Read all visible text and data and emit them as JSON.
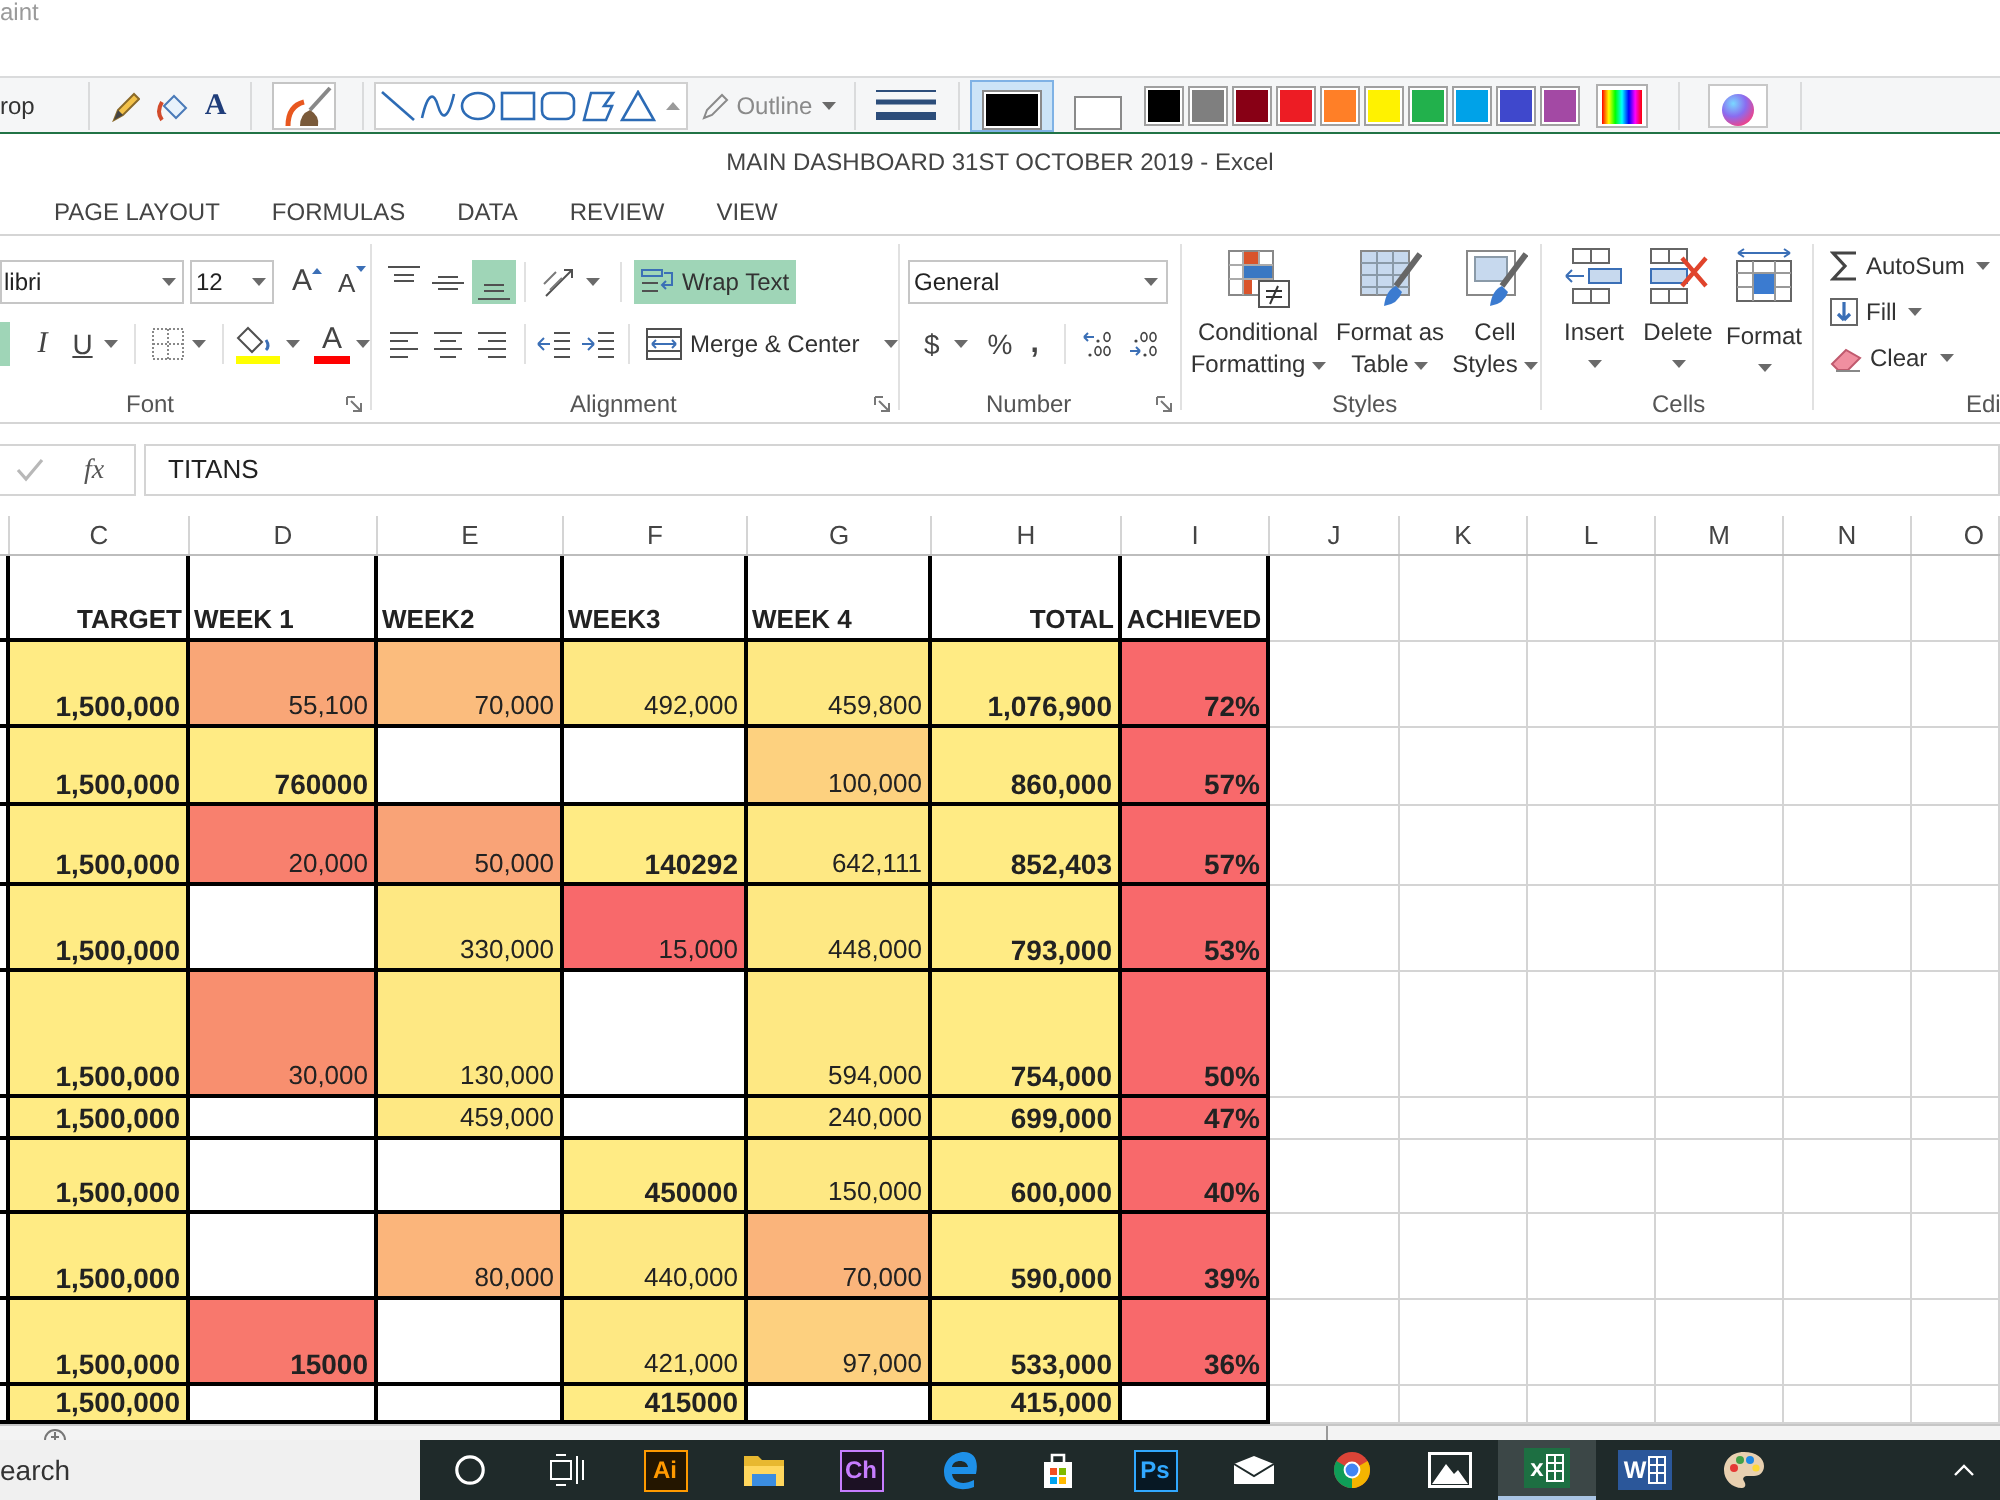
{
  "paint_window": {
    "title": "aint",
    "crop_label": "rop",
    "text_tool": "A",
    "outline": {
      "label": "Outline"
    },
    "current_colors": [
      {
        "color": "#000000",
        "selected": true
      },
      {
        "color": "#ffffff",
        "selected": false
      }
    ],
    "palette": [
      {
        "color": "#000000"
      },
      {
        "color": "#7f7f7f"
      },
      {
        "color": "#880015"
      },
      {
        "color": "#ed1c24"
      },
      {
        "color": "#ff7f27"
      },
      {
        "color": "#fff200"
      },
      {
        "color": "#22b14c"
      },
      {
        "color": "#00a2e8"
      },
      {
        "color": "#3f48cc"
      },
      {
        "color": "#a349a4"
      }
    ]
  },
  "excel": {
    "title": "MAIN DASHBOARD 31ST OCTOBER 2019 - Excel",
    "tabs": [
      {
        "label": "PAGE LAYOUT",
        "selected": false
      },
      {
        "label": "FORMULAS",
        "selected": false
      },
      {
        "label": "DATA",
        "selected": false
      },
      {
        "label": "REVIEW",
        "selected": false
      },
      {
        "label": "VIEW",
        "selected": false
      }
    ],
    "ribbon": {
      "font": {
        "label": "Font",
        "font_name": "libri",
        "font_size": "12",
        "grow_font": "A",
        "shrink_font": "A",
        "bold": {
          "on": true
        },
        "italic": {
          "label": "I",
          "on": false
        },
        "underline": {
          "label": "U",
          "on": false
        },
        "fill_color": {
          "color": "#ffff00"
        },
        "font_color": {
          "label": "A",
          "color": "#ff0000"
        }
      },
      "alignment": {
        "label": "Alignment",
        "top_align": {
          "on": false
        },
        "middle_align": {
          "on": false
        },
        "bottom_align": {
          "on": true
        },
        "left_align": {
          "on": false
        },
        "center_align": {
          "on": false
        },
        "right_align": {
          "on": false
        },
        "wrap_text": {
          "label": "Wrap Text",
          "on": true
        },
        "merge_center": {
          "label": "Merge & Center"
        }
      },
      "number": {
        "label": "Number",
        "format": "General",
        "currency": "$",
        "percent": "%",
        "comma": ","
      },
      "styles": {
        "label": "Styles",
        "buttons": [
          {
            "kind": "conditional_formatting",
            "label": "Conditional Formatting"
          },
          {
            "kind": "format_table",
            "label": "Format as Table"
          },
          {
            "kind": "cell_styles",
            "label": "Cell Styles"
          }
        ]
      },
      "cells": {
        "label": "Cells",
        "buttons": [
          {
            "kind": "insert",
            "label": "Insert"
          },
          {
            "kind": "delete",
            "label": "Delete"
          },
          {
            "kind": "format",
            "label": "Format"
          }
        ]
      },
      "editing": {
        "label": "Edi",
        "buttons": [
          {
            "kind": "autosum",
            "label": "AutoSum"
          },
          {
            "kind": "fill",
            "label": "Fill"
          },
          {
            "kind": "clear",
            "label": "Clear"
          }
        ]
      }
    },
    "formula_bar": {
      "function_label": "fx",
      "value": "TITANS"
    },
    "sheet": {
      "column_letters": [
        "C",
        "D",
        "E",
        "F",
        "G",
        "H",
        "I",
        "J",
        "K",
        "L",
        "M",
        "N",
        "O"
      ],
      "table": {
        "columns": [
          "TARGET",
          "WEEK 1",
          "WEEK2",
          "WEEK3",
          "WEEK 4",
          "TOTAL",
          "ACHIEVED"
        ],
        "rows": [
          {
            "cells": [
              {
                "value": "1,500,000",
                "color": "#ffeb84",
                "bold": true
              },
              {
                "value": "55,100",
                "color": "#f9a677",
                "bold": false
              },
              {
                "value": "70,000",
                "color": "#fbbc7d",
                "bold": false
              },
              {
                "value": "492,000",
                "color": "#fee883",
                "bold": false
              },
              {
                "value": "459,800",
                "color": "#fee883",
                "bold": false
              },
              {
                "value": "1,076,900",
                "color": "#ffeb84",
                "bold": true
              },
              {
                "value": "72%",
                "color": "#f8696b",
                "bold": true
              }
            ]
          },
          {
            "cells": [
              {
                "value": "1,500,000",
                "color": "#ffeb84",
                "bold": true
              },
              {
                "value": "760000",
                "color": "#ffeb84",
                "bold": true
              },
              {
                "color": "#ffffff"
              },
              {
                "color": "#ffffff"
              },
              {
                "value": "100,000",
                "color": "#fdd17f",
                "bold": false
              },
              {
                "value": "860,000",
                "color": "#ffeb84",
                "bold": true
              },
              {
                "value": "57%",
                "color": "#f8696b",
                "bold": true
              }
            ]
          },
          {
            "cells": [
              {
                "value": "1,500,000",
                "color": "#ffeb84",
                "bold": true
              },
              {
                "value": "20,000",
                "color": "#f8806e",
                "bold": false
              },
              {
                "value": "50,000",
                "color": "#f9a377",
                "bold": false
              },
              {
                "value": "140292",
                "color": "#ffeb84",
                "bold": true
              },
              {
                "value": "642,111",
                "color": "#fee883",
                "bold": false
              },
              {
                "value": "852,403",
                "color": "#ffeb84",
                "bold": true
              },
              {
                "value": "57%",
                "color": "#f8696b",
                "bold": true
              }
            ]
          },
          {
            "cells": [
              {
                "value": "1,500,000",
                "color": "#ffeb84",
                "bold": true
              },
              {
                "color": "#ffffff"
              },
              {
                "value": "330,000",
                "color": "#fee883",
                "bold": false
              },
              {
                "value": "15,000",
                "color": "#f8696b",
                "bold": false
              },
              {
                "value": "448,000",
                "color": "#fee883",
                "bold": false
              },
              {
                "value": "793,000",
                "color": "#ffeb84",
                "bold": true
              },
              {
                "value": "53%",
                "color": "#f8696b",
                "bold": true
              }
            ]
          },
          {
            "cells": [
              {
                "value": "1,500,000",
                "color": "#ffeb84",
                "bold": true
              },
              {
                "value": "30,000",
                "color": "#f88f6f",
                "bold": false
              },
              {
                "value": "130,000",
                "color": "#fee883",
                "bold": false
              },
              {
                "color": "#ffffff"
              },
              {
                "value": "594,000",
                "color": "#fee883",
                "bold": false
              },
              {
                "value": "754,000",
                "color": "#ffeb84",
                "bold": true
              },
              {
                "value": "50%",
                "color": "#f8696b",
                "bold": true
              }
            ]
          },
          {
            "cells": [
              {
                "value": "1,500,000",
                "color": "#ffeb84",
                "bold": true
              },
              {
                "color": "#ffffff"
              },
              {
                "value": "459,000",
                "color": "#fee883",
                "bold": false
              },
              {
                "color": "#ffffff"
              },
              {
                "value": "240,000",
                "color": "#fee883",
                "bold": false
              },
              {
                "value": "699,000",
                "color": "#ffeb84",
                "bold": true
              },
              {
                "value": "47%",
                "color": "#f8696b",
                "bold": true
              }
            ]
          },
          {
            "cells": [
              {
                "value": "1,500,000",
                "color": "#ffeb84",
                "bold": true
              },
              {
                "color": "#ffffff"
              },
              {
                "color": "#ffffff"
              },
              {
                "value": "450000",
                "color": "#ffeb84",
                "bold": true
              },
              {
                "value": "150,000",
                "color": "#fee883",
                "bold": false
              },
              {
                "value": "600,000",
                "color": "#ffeb84",
                "bold": true
              },
              {
                "value": "40%",
                "color": "#f8696b",
                "bold": true
              }
            ]
          },
          {
            "cells": [
              {
                "value": "1,500,000",
                "color": "#ffeb84",
                "bold": true
              },
              {
                "color": "#ffffff"
              },
              {
                "value": "80,000",
                "color": "#fbb57b",
                "bold": false
              },
              {
                "value": "440,000",
                "color": "#fee883",
                "bold": false
              },
              {
                "value": "70,000",
                "color": "#fab47b",
                "bold": false
              },
              {
                "value": "590,000",
                "color": "#ffeb84",
                "bold": true
              },
              {
                "value": "39%",
                "color": "#f8696b",
                "bold": true
              }
            ]
          },
          {
            "cells": [
              {
                "value": "1,500,000",
                "color": "#ffeb84",
                "bold": true
              },
              {
                "value": "15000",
                "color": "#f8786d",
                "bold": true
              },
              {
                "color": "#ffffff"
              },
              {
                "value": "421,000",
                "color": "#fee883",
                "bold": false
              },
              {
                "value": "97,000",
                "color": "#fdd07f",
                "bold": false
              },
              {
                "value": "533,000",
                "color": "#ffeb84",
                "bold": true
              },
              {
                "value": "36%",
                "color": "#f8696b",
                "bold": true
              }
            ]
          },
          {
            "cells": [
              {
                "value": "1,500,000",
                "color": "#ffeb84",
                "bold": true
              },
              {
                "color": "#ffffff"
              },
              {
                "color": "#ffffff"
              },
              {
                "value": "415000",
                "color": "#ffeb84",
                "bold": true
              },
              {
                "color": "#ffffff"
              },
              {
                "value": "415,000",
                "color": "#ffeb84",
                "bold": true
              },
              {
                "color": "#ffffff"
              }
            ]
          }
        ]
      }
    }
  },
  "taskbar": {
    "search": {
      "placeholder": "earch"
    },
    "apps": [
      {
        "kind": "ring",
        "selected": false
      },
      {
        "kind": "task_view",
        "selected": false
      },
      {
        "kind": "letter_tile",
        "label": "Ai",
        "color": "#ff9a00",
        "selected": false
      },
      {
        "kind": "folder",
        "selected": false
      },
      {
        "kind": "letter_tile",
        "label": "Ch",
        "color": "#c77dff",
        "selected": false
      },
      {
        "kind": "browser_e",
        "selected": false
      },
      {
        "kind": "store",
        "selected": false
      },
      {
        "kind": "letter_tile",
        "label": "Ps",
        "color": "#31a8ff",
        "selected": false
      },
      {
        "kind": "mail",
        "selected": false
      },
      {
        "kind": "browser_ring",
        "selected": false
      },
      {
        "kind": "photos",
        "selected": false
      },
      {
        "kind": "sheet_tile",
        "label": "x",
        "color": "#1d6f42",
        "selected": true
      },
      {
        "kind": "doc_tile",
        "label": "W",
        "color": "#2b579a",
        "selected": false
      },
      {
        "kind": "palette",
        "selected": false
      }
    ]
  }
}
